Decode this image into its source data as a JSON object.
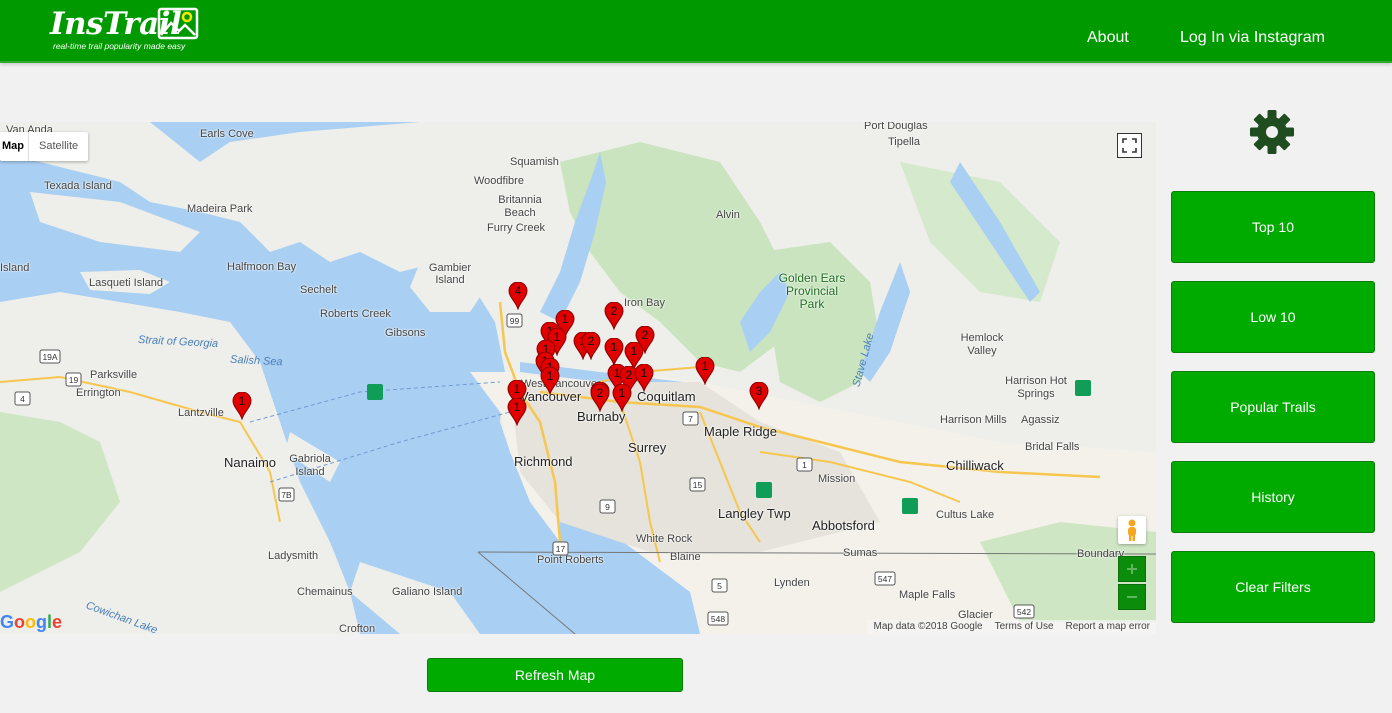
{
  "navbar": {
    "brand": "InsTrail",
    "tagline": "real-time trail popularity made easy",
    "links": [
      "About",
      "Log In via Instagram"
    ]
  },
  "map": {
    "type_controls": [
      "Map",
      "Satellite"
    ],
    "attribution": [
      "Map data ©2018 Google",
      "Terms of Use",
      "Report a map error"
    ],
    "google_logo": "Google",
    "labels": [
      "Van Anda",
      "Earls Cove",
      "Port Douglas",
      "Tipella",
      "Squamish",
      "Texada Island",
      "Woodfibre",
      "Britannia Beach",
      "Madeira Park",
      "Alvin",
      "Furry Creek",
      "Island",
      "Halfmoon Bay",
      "Gambier Island",
      "Golden Ears Provincial Park",
      "Lasqueti Island",
      "Sechelt",
      "Iron Bay",
      "Roberts Creek",
      "Gibsons",
      "Hemlock Valley",
      "Strait of Georgia",
      "Salish Sea",
      "Parksville",
      "Errington",
      "Harrison Hot Springs",
      "Vancouver",
      "Coquitlam",
      "Lantzville",
      "Burnaby",
      "Harrison Mills",
      "Agassiz",
      "Maple Ridge",
      "Bridal Falls",
      "Nanaimo",
      "Gabriola Island",
      "Richmond",
      "Surrey",
      "Chilliwack",
      "Mission",
      "Langley Twp",
      "Abbotsford",
      "Cultus Lake",
      "White Rock",
      "Ladysmith",
      "Blaine",
      "Sumas",
      "Boundary",
      "Point Roberts",
      "Lynden",
      "Chemainus",
      "Galiano Island",
      "Maple Falls",
      "Glacier",
      "Crofton",
      "Cowichan Lake",
      "Stave Lake",
      "West Vancouver"
    ],
    "highway_labels": [
      "99",
      "19A",
      "19",
      "4",
      "17",
      "5",
      "15",
      "1",
      "7",
      "7B",
      "547",
      "548",
      "542",
      "546",
      "9"
    ],
    "markers": [
      4,
      1,
      2,
      1,
      1,
      1,
      2,
      2,
      1,
      1,
      1,
      1,
      1,
      1,
      2,
      1,
      1,
      1,
      2,
      1,
      1,
      1,
      3,
      1,
      1
    ]
  },
  "sidebar": {
    "settings_icon": "gear-icon",
    "buttons": [
      "Top 10",
      "Low 10",
      "Popular Trails",
      "History",
      "Clear Filters"
    ]
  },
  "refresh_label": "Refresh Map",
  "colors": {
    "brand_green": "#009a00",
    "button_green": "#00ab00",
    "marker_red": "#e00000",
    "water": "#a9cff2",
    "gear": "#1f4d1f"
  }
}
